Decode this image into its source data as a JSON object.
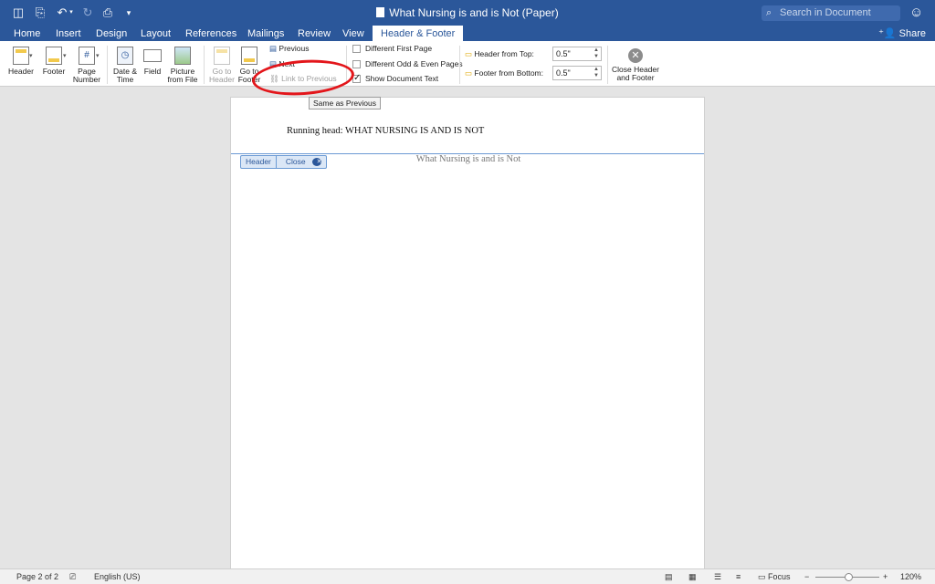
{
  "window": {
    "title": "What Nursing is and is Not (Paper)",
    "search_placeholder": "Search in Document"
  },
  "tabs": [
    {
      "label": "Home"
    },
    {
      "label": "Insert"
    },
    {
      "label": "Design"
    },
    {
      "label": "Layout"
    },
    {
      "label": "References"
    },
    {
      "label": "Mailings"
    },
    {
      "label": "Review"
    },
    {
      "label": "View"
    },
    {
      "label": "Header & Footer"
    }
  ],
  "share_label": "Share",
  "ribbon": {
    "header": "Header",
    "footer": "Footer",
    "page_number_1": "Page",
    "page_number_2": "Number",
    "date_time_1": "Date &",
    "date_time_2": "Time",
    "field": "Field",
    "picture_1": "Picture",
    "picture_2": "from File",
    "go_to_header_1": "Go to",
    "go_to_header_2": "Header",
    "go_to_footer_1": "Go to",
    "go_to_footer_2": "Footer",
    "previous": "Previous",
    "next": "Next",
    "link_to_previous": "Link to Previous",
    "different_first_page": "Different First Page",
    "different_odd_even": "Different Odd & Even Pages",
    "show_document_text": "Show Document Text",
    "header_from_top_label": "Header from Top:",
    "header_from_top_value": "0.5\"",
    "footer_from_bottom_label": "Footer from Bottom:",
    "footer_from_bottom_value": "0.5\"",
    "close_hf_1": "Close Header",
    "close_hf_2": "and Footer"
  },
  "document": {
    "tooltip": "Same as Previous",
    "running_head": "Running head: WHAT NURSING IS AND IS NOT",
    "header_tag": "Header",
    "close_tag": "Close",
    "body_title": "What Nursing is and is Not"
  },
  "status": {
    "page": "Page 2 of 2",
    "language": "English (US)",
    "focus": "Focus",
    "zoom": "120%",
    "zoom_level_percent": 120
  },
  "colors": {
    "brand": "#2b579a",
    "annotation": "#e3161b"
  }
}
